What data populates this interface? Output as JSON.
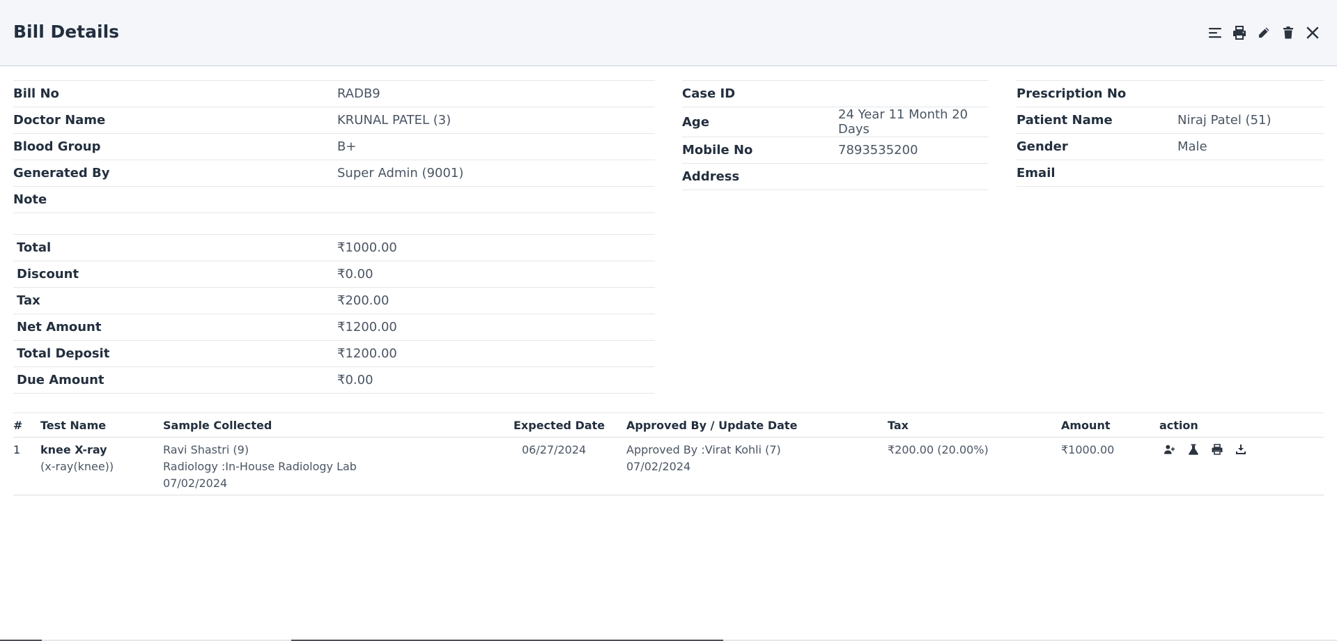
{
  "header": {
    "title": "Bill Details",
    "icons": [
      "menu-icon",
      "print-icon",
      "edit-icon",
      "delete-icon",
      "close-icon"
    ]
  },
  "bill": {
    "left": [
      {
        "label": "Bill No",
        "value": "RADB9"
      },
      {
        "label": "Doctor Name",
        "value": "KRUNAL PATEL (3)"
      },
      {
        "label": "Blood Group",
        "value": "B+"
      },
      {
        "label": "Generated By",
        "value": "Super Admin (9001)"
      },
      {
        "label": "Note",
        "value": ""
      }
    ],
    "middle": [
      {
        "label": "Case ID",
        "value": ""
      },
      {
        "label": "Age",
        "value": "24 Year 11 Month 20 Days"
      },
      {
        "label": "Mobile No",
        "value": "7893535200"
      },
      {
        "label": "Address",
        "value": ""
      }
    ],
    "right": [
      {
        "label": "Prescription No",
        "value": ""
      },
      {
        "label": "Patient Name",
        "value": "Niraj Patel (51)"
      },
      {
        "label": "Gender",
        "value": "Male"
      },
      {
        "label": "Email",
        "value": ""
      }
    ]
  },
  "totals": [
    {
      "label": "Total",
      "value": "₹1000.00"
    },
    {
      "label": "Discount",
      "value": "₹0.00"
    },
    {
      "label": "Tax",
      "value": "₹200.00"
    },
    {
      "label": "Net Amount",
      "value": "₹1200.00"
    },
    {
      "label": "Total Deposit",
      "value": "₹1200.00"
    },
    {
      "label": "Due Amount",
      "value": "₹0.00"
    }
  ],
  "tests": {
    "columns": [
      "#",
      "Test Name",
      "Sample Collected",
      "Expected Date",
      "Approved By / Update Date",
      "Tax",
      "Amount",
      "action"
    ],
    "rows": [
      {
        "num": "1",
        "test_name": "knee X-ray",
        "test_short": "(x-ray(knee))",
        "sample_by": "Ravi Shastri (9)",
        "sample_lab": "Radiology :In-House Radiology Lab",
        "sample_date": "07/02/2024",
        "expected_date": "06/27/2024",
        "approved_by": "Approved By :Virat Kohli (7)",
        "update_date": "07/02/2024",
        "tax": "₹200.00 (20.00%)",
        "amount": "₹1000.00",
        "actions": [
          "add-user-icon",
          "flask-icon",
          "print-icon",
          "download-icon"
        ]
      }
    ]
  }
}
